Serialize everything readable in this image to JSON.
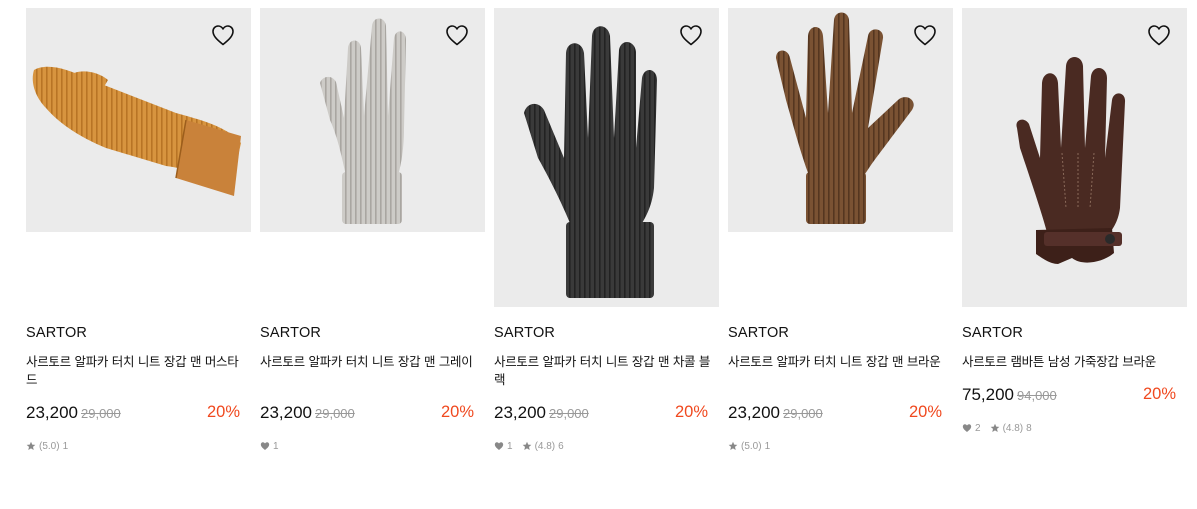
{
  "colors": {
    "discount": "#f0491f",
    "image_bg": "#ebebeb",
    "muted": "#999999"
  },
  "products": [
    {
      "brand": "SARTOR",
      "name": "사르토르 알파카 터치 니트 장갑 맨 머스타드",
      "price": "23,200",
      "original_price": "29,000",
      "discount": "20%",
      "likes": null,
      "rating": "(5.0)",
      "review_count": "1",
      "image_icon": "mustard-knit-glove",
      "wishlist_icon": "heart-outline-icon"
    },
    {
      "brand": "SARTOR",
      "name": "사르토르 알파카 터치 니트 장갑 맨 그레이",
      "price": "23,200",
      "original_price": "29,000",
      "discount": "20%",
      "likes": "1",
      "rating": null,
      "review_count": null,
      "image_icon": "gray-knit-glove",
      "wishlist_icon": "heart-outline-icon"
    },
    {
      "brand": "SARTOR",
      "name": "사르토르 알파카 터치 니트 장갑 맨 차콜 블랙",
      "price": "23,200",
      "original_price": "29,000",
      "discount": "20%",
      "likes": "1",
      "rating": "(4.8)",
      "review_count": "6",
      "image_icon": "charcoal-knit-glove",
      "wishlist_icon": "heart-outline-icon"
    },
    {
      "brand": "SARTOR",
      "name": "사르토르 알파카 터치 니트 장갑 맨 브라운",
      "price": "23,200",
      "original_price": "29,000",
      "discount": "20%",
      "likes": null,
      "rating": "(5.0)",
      "review_count": "1",
      "image_icon": "brown-knit-glove",
      "wishlist_icon": "heart-outline-icon"
    },
    {
      "brand": "SARTOR",
      "name": "사르토르 램바튼 남성 가죽장갑 브라운",
      "price": "75,200",
      "original_price": "94,000",
      "discount": "20%",
      "likes": "2",
      "rating": "(4.8)",
      "review_count": "8",
      "image_icon": "brown-leather-glove",
      "wishlist_icon": "heart-outline-icon"
    }
  ]
}
